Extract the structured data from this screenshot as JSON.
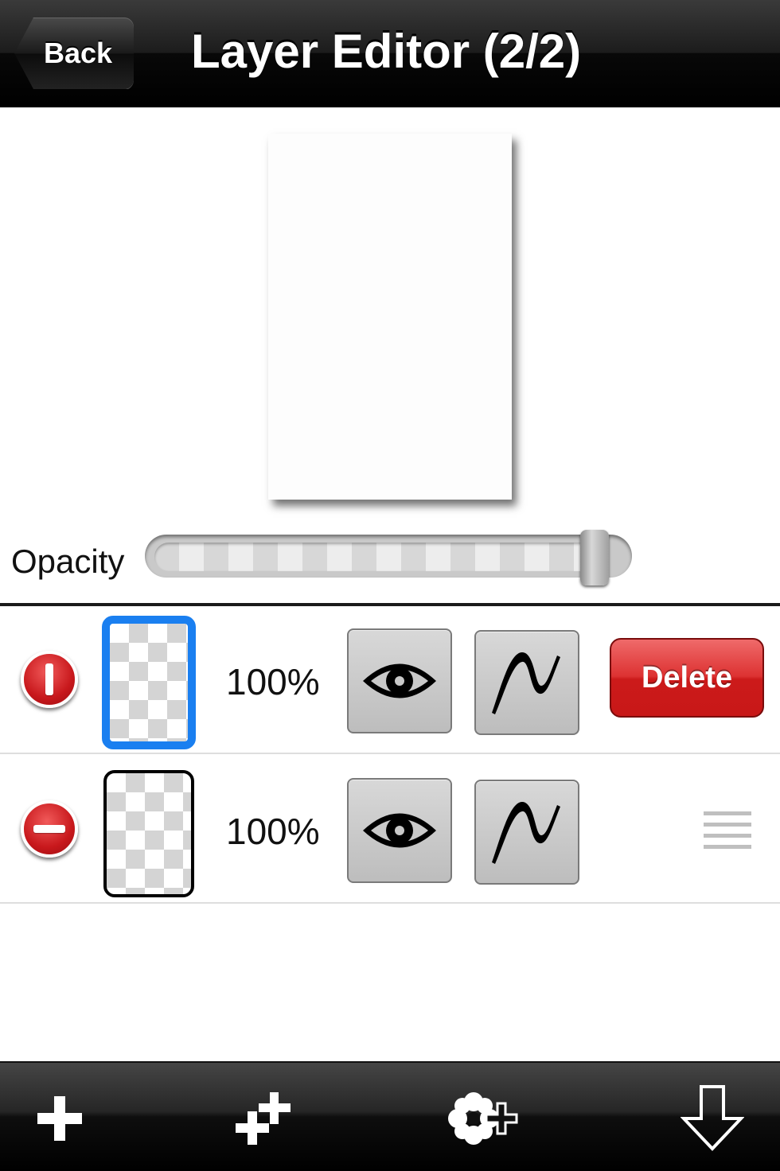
{
  "navbar": {
    "back_label": "Back",
    "title": "Layer Editor (2/2)"
  },
  "opacity": {
    "label": "Opacity",
    "value_fraction": 0.97
  },
  "layers": [
    {
      "opacity_text": "100%",
      "selected": true,
      "delete_label": "Delete",
      "delete_confirm_visible": true
    },
    {
      "opacity_text": "100%",
      "selected": false,
      "reorder_visible": true
    }
  ],
  "toolbar": {
    "items": [
      "add-layer-icon",
      "duplicate-layer-icon",
      "add-from-gallery-icon",
      "merge-down-icon"
    ]
  },
  "colors": {
    "selection_accent": "#1a7ff0",
    "delete_red": "#d42a2a",
    "nav_bar": "#000000"
  }
}
